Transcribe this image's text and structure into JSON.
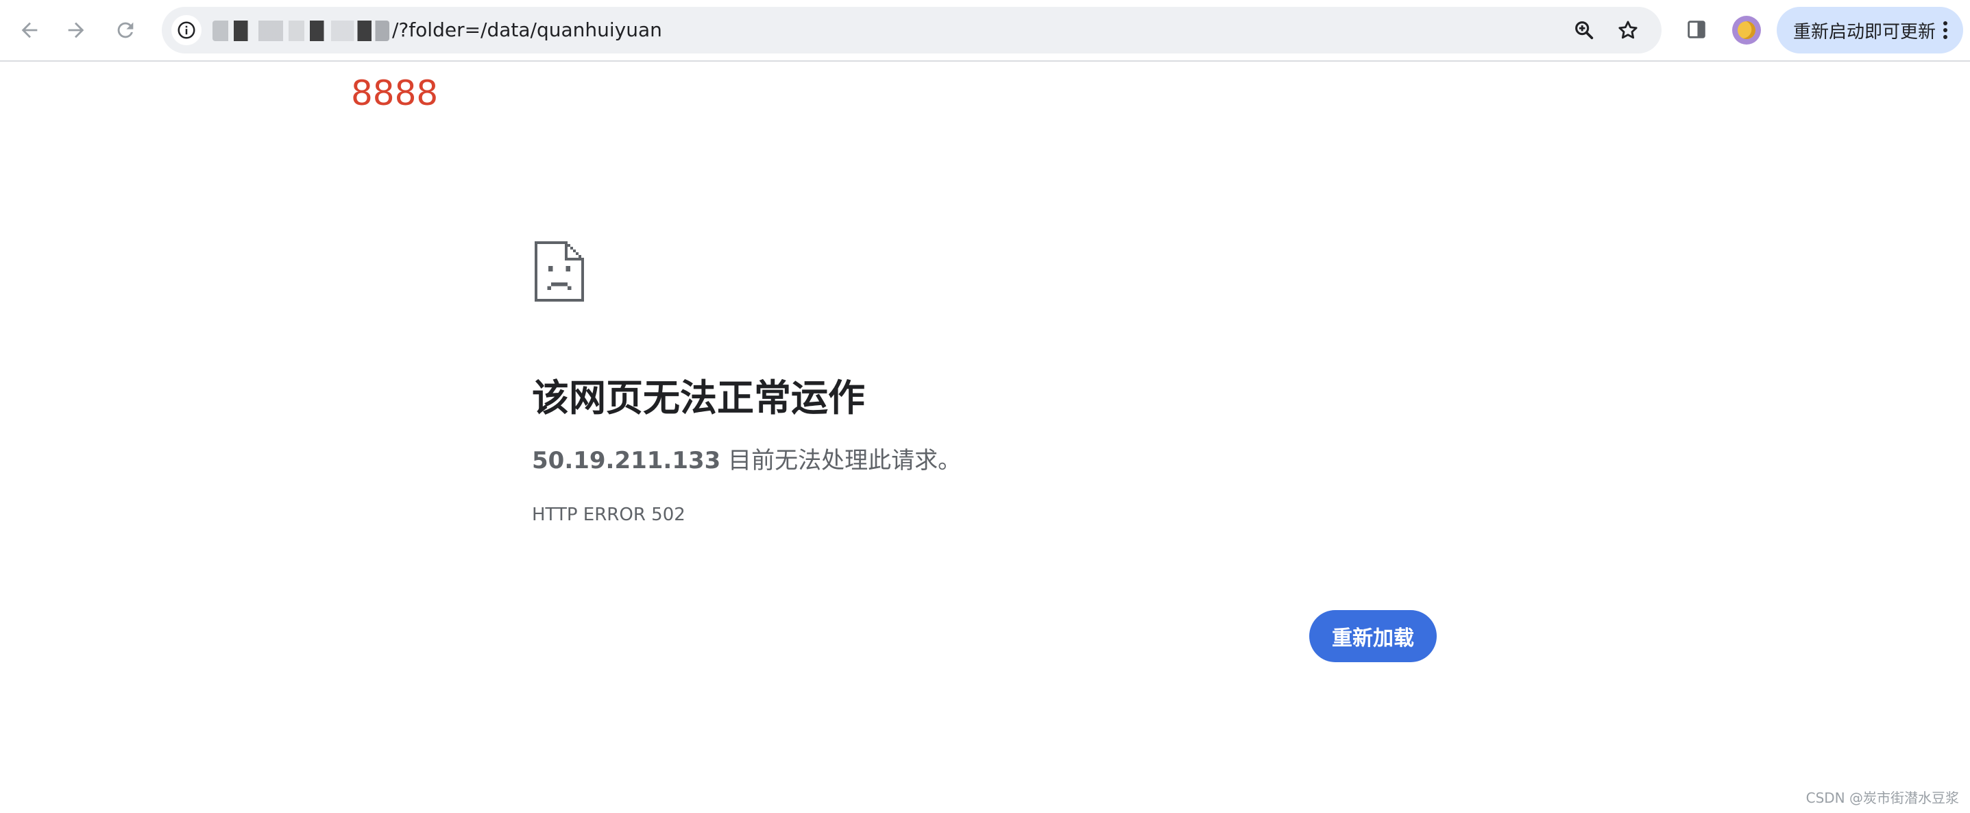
{
  "toolbar": {
    "back_icon": "arrow-left-icon",
    "forward_icon": "arrow-right-icon",
    "reload_icon": "reload-icon",
    "url_visible": "/?folder=/data/quanhuiyuan",
    "zoom_icon": "zoom-in-icon",
    "bookmark_icon": "star-icon",
    "side_panel_icon": "side-panel-icon",
    "update_label": "重新启动即可更新"
  },
  "page": {
    "port_tag": "8888",
    "title": "该网页无法正常运作",
    "host": "50.19.211.133",
    "description": " 目前无法处理此请求。",
    "error_code": "HTTP ERROR 502",
    "reload_label": "重新加载"
  },
  "watermark": "CSDN @炭市街潜水豆浆",
  "colors": {
    "accent": "#3a6fde",
    "port_tag": "#d9432e",
    "update_button": "#d3e3fd"
  }
}
